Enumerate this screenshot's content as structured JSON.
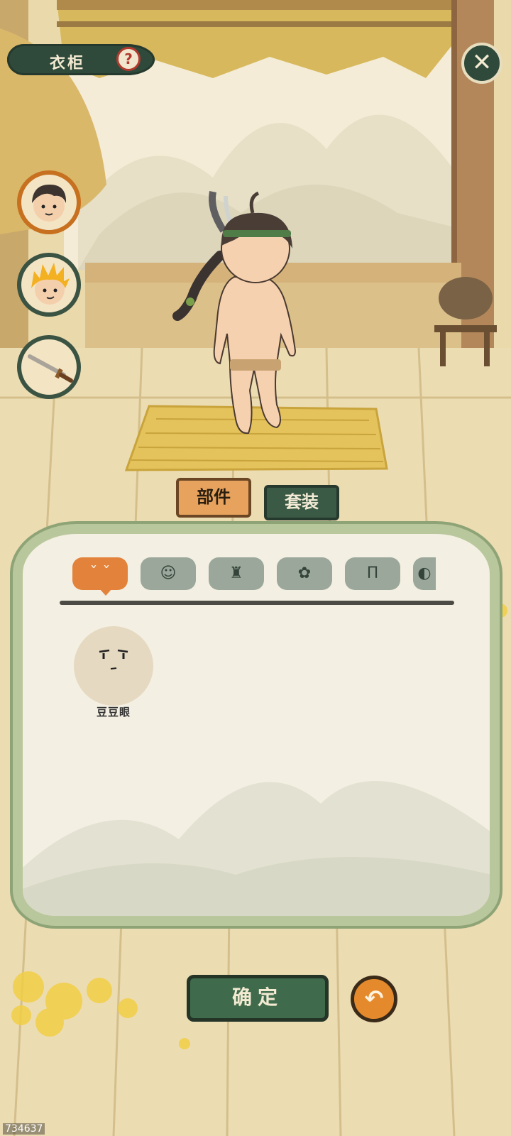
{
  "header": {
    "title": "衣柜",
    "help_icon": "question-mark-icon",
    "close_icon": "close-icon"
  },
  "side_buttons": [
    {
      "name": "character-portrait-1",
      "selected": true
    },
    {
      "name": "character-portrait-2",
      "selected": false
    },
    {
      "name": "weapon-sword",
      "selected": false
    }
  ],
  "tabs": {
    "parts": "部件",
    "sets": "套装",
    "active": "parts"
  },
  "categories": [
    {
      "icon": "face-icon",
      "active": true
    },
    {
      "icon": "hair-icon",
      "active": false
    },
    {
      "icon": "clothes-icon",
      "active": false
    },
    {
      "icon": "flower-accessory-icon",
      "active": false
    },
    {
      "icon": "pants-icon",
      "active": false
    },
    {
      "icon": "more-category-icon",
      "active": false
    }
  ],
  "items": [
    {
      "label": "豆豆眼",
      "selected": false
    }
  ],
  "buttons": {
    "confirm": "确定",
    "undo_icon": "undo-arrow-icon"
  },
  "watermark": "734637",
  "colors": {
    "dark_green": "#2f4a3b",
    "accent_orange": "#e3833b",
    "panel_border": "#b9c79c"
  }
}
